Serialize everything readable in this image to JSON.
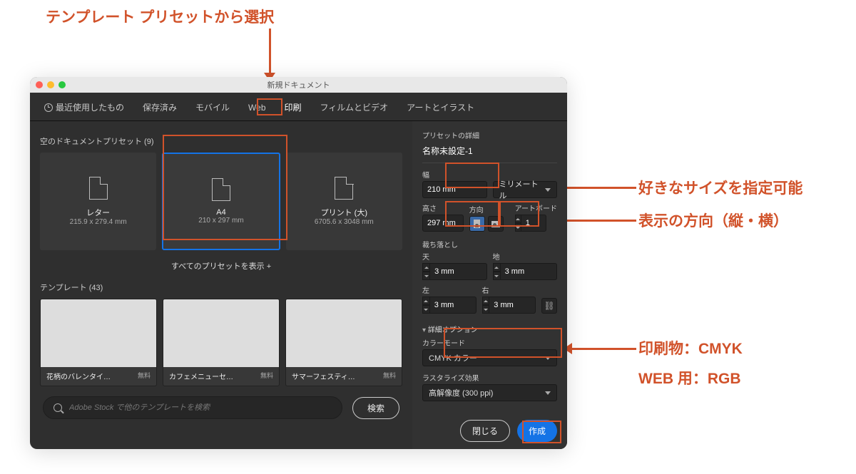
{
  "annotations": {
    "top": "テンプレート プリセットから選択",
    "size": "好きなサイズを指定可能",
    "orientation": "表示の方向（縦・横）",
    "colormode1": "印刷物：CMYK",
    "colormode2": "WEB 用：RGB"
  },
  "titlebar": {
    "title": "新規ドキュメント"
  },
  "tabs": {
    "recent": "最近使用したもの",
    "saved": "保存済み",
    "mobile": "モバイル",
    "web": "Web",
    "print": "印刷",
    "film": "フィルムとビデオ",
    "art": "アートとイラスト"
  },
  "left": {
    "blank_label": "空のドキュメントプリセット  (9)",
    "presets": [
      {
        "name": "レター",
        "dim": "215.9 x 279.4 mm"
      },
      {
        "name": "A4",
        "dim": "210 x 297 mm"
      },
      {
        "name": "プリント (大)",
        "dim": "6705.6 x 3048 mm"
      }
    ],
    "show_all": "すべてのプリセットを表示 +",
    "template_label": "テンプレート  (43)",
    "templates": [
      {
        "name": "花柄のバレンタイ…",
        "free": "無料"
      },
      {
        "name": "カフェメニューセ…",
        "free": "無料"
      },
      {
        "name": "サマーフェスティ…",
        "free": "無料"
      }
    ],
    "search_placeholder": "Adobe Stock で他のテンプレートを検索",
    "search_btn": "検索"
  },
  "right": {
    "details_label": "プリセットの詳細",
    "doc_name": "名称未設定-1",
    "width_label": "幅",
    "width_value": "210 mm",
    "unit_value": "ミリメートル",
    "height_label": "高さ",
    "height_value": "297 mm",
    "orient_label": "方向",
    "artboard_label": "アートボード",
    "artboard_value": "1",
    "bleed_label": "裁ち落とし",
    "top_l": "天",
    "bottom_l": "地",
    "left_l": "左",
    "right_l": "右",
    "bleed_value": "3 mm",
    "adv_label": "詳細オプション",
    "colormode_label": "カラーモード",
    "colormode_value": "CMYK カラー",
    "raster_label": "ラスタライズ効果",
    "raster_value": "高解像度 (300 ppi)",
    "close_btn": "閉じる",
    "create_btn": "作成"
  }
}
